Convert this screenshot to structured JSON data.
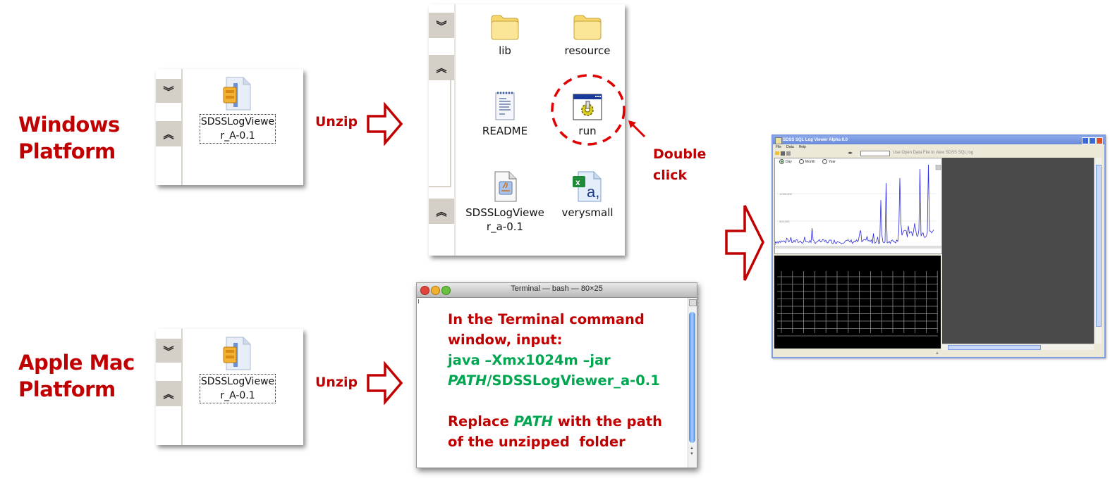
{
  "colors": {
    "label_red": "#c00000",
    "command_green": "#00a650",
    "highlight_circle": "#e00000",
    "xp_titlebar": "#7f9de0",
    "chart_line": "#2a2ae0",
    "grid_bg": "#000000",
    "dark_pane": "#4a4a4a"
  },
  "windows_section": {
    "platform_label_line1": "Windows",
    "platform_label_line2": "Platform",
    "zip_file": {
      "name_line1": "SDSSLogViewe",
      "name_line2": "r_A-0.1",
      "icon": "zip-archive-icon"
    },
    "step_label": "Unzip",
    "unzipped_files": [
      {
        "name": "lib",
        "icon": "folder-icon"
      },
      {
        "name": "resource",
        "icon": "folder-icon"
      },
      {
        "name": "README",
        "icon": "text-document-icon"
      },
      {
        "name": "run",
        "icon": "batch-file-icon",
        "highlighted": true
      },
      {
        "name_line1": "SDSSLogViewe",
        "name_line2": "r_a-0.1",
        "icon": "java-jar-icon"
      },
      {
        "name": "verysmall",
        "icon": "excel-csv-icon"
      }
    ],
    "action_line1": "Double",
    "action_line2": "click"
  },
  "mac_section": {
    "platform_label_line1": "Apple Mac",
    "platform_label_line2": "Platform",
    "zip_file": {
      "name_line1": "SDSSLogViewe",
      "name_line2": "r_A-0.1",
      "icon": "zip-archive-icon"
    },
    "step_label": "Unzip",
    "terminal": {
      "title": "Terminal — bash — 80×25",
      "instruction_line1": "In the Terminal command",
      "instruction_line2": "window, input:",
      "command_line1": "java –Xmx1024m –jar",
      "command_path_italic": "PATH",
      "command_line2_rest": "/SDSSLogViewer_a-0.1",
      "replace_prefix": "Replace ",
      "replace_path_italic": "PATH",
      "replace_suffix": " with the path",
      "replace_line2": "of the unzipped  folder"
    }
  },
  "result_app": {
    "title": "SDSS SQL Log Viewer Alpha 0.0",
    "menu": [
      "File",
      "Data",
      "Help"
    ],
    "toolbar_hint": "Use Open Data File to view SDSS SQL log",
    "radio_options": [
      {
        "label": "Day",
        "selected": true
      },
      {
        "label": "Month",
        "selected": false
      },
      {
        "label": "Year",
        "selected": false
      }
    ],
    "chart_ticks": [
      "1,000,000",
      "500,000"
    ]
  }
}
